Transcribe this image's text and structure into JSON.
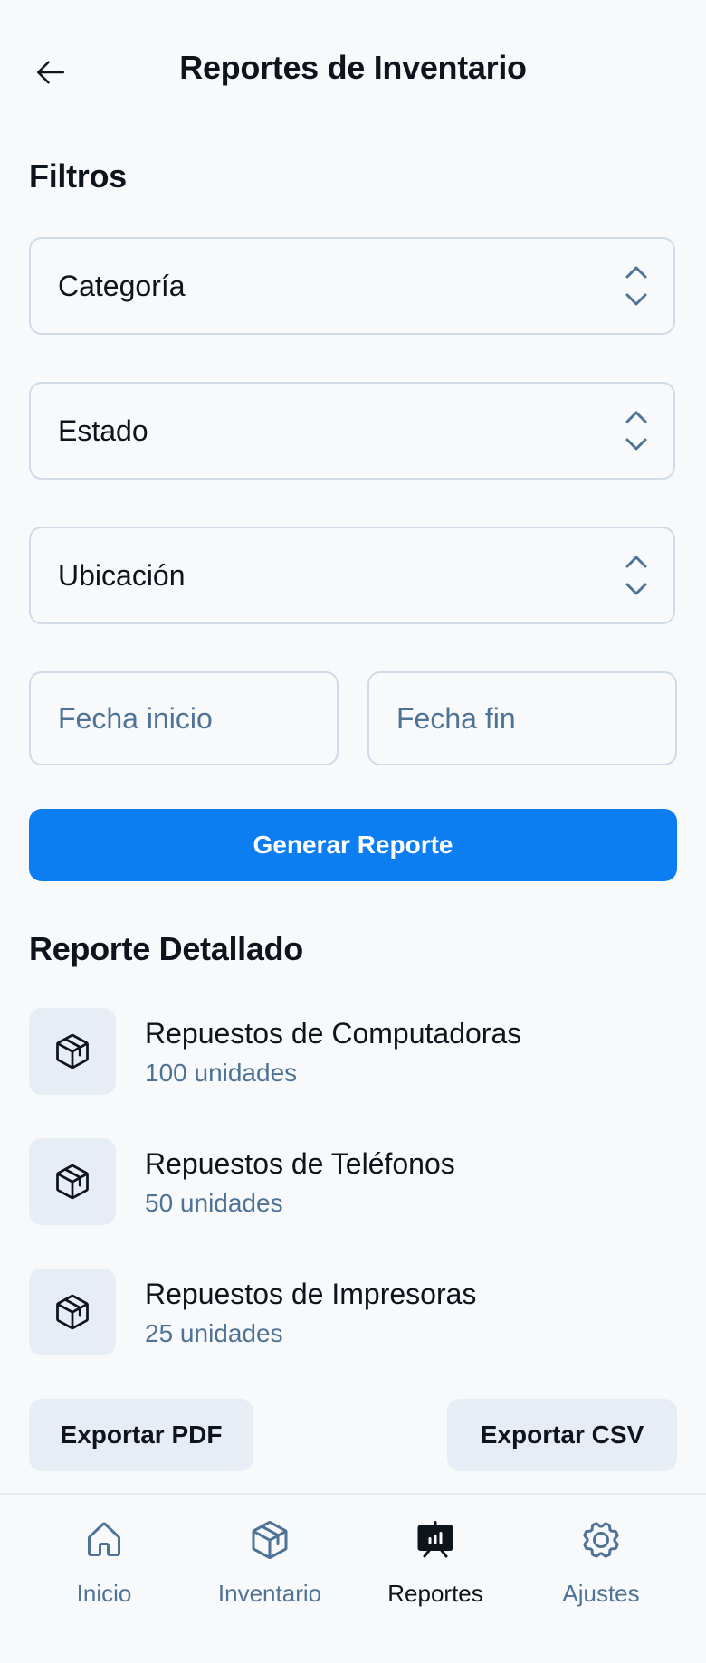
{
  "header": {
    "title": "Reportes de Inventario"
  },
  "filters": {
    "title": "Filtros",
    "selects": [
      {
        "label": "Categoría"
      },
      {
        "label": "Estado"
      },
      {
        "label": "Ubicación"
      }
    ],
    "date_start": {
      "placeholder": "Fecha inicio"
    },
    "date_end": {
      "placeholder": "Fecha fin"
    },
    "generate_label": "Generar Reporte"
  },
  "report": {
    "title": "Reporte Detallado",
    "items": [
      {
        "name": "Repuestos de Computadoras",
        "quantity": "100 unidades",
        "icon": "package-icon"
      },
      {
        "name": "Repuestos de Teléfonos",
        "quantity": "50 unidades",
        "icon": "package-icon"
      },
      {
        "name": "Repuestos de Impresoras",
        "quantity": "25 unidades",
        "icon": "package-icon"
      }
    ]
  },
  "export": {
    "pdf_label": "Exportar PDF",
    "csv_label": "Exportar CSV"
  },
  "nav": {
    "items": [
      {
        "label": "Inicio",
        "icon": "house-icon",
        "active": false
      },
      {
        "label": "Inventario",
        "icon": "package-icon",
        "active": false
      },
      {
        "label": "Reportes",
        "icon": "presentation-chart-icon",
        "active": true
      },
      {
        "label": "Ajustes",
        "icon": "gear-icon",
        "active": false
      }
    ]
  },
  "colors": {
    "background": "#f8f9fb",
    "primary": "#0d7df2",
    "text": "#0e141b",
    "muted": "#4e7397",
    "border": "#d0dbe7",
    "tile": "#e7edf4"
  }
}
